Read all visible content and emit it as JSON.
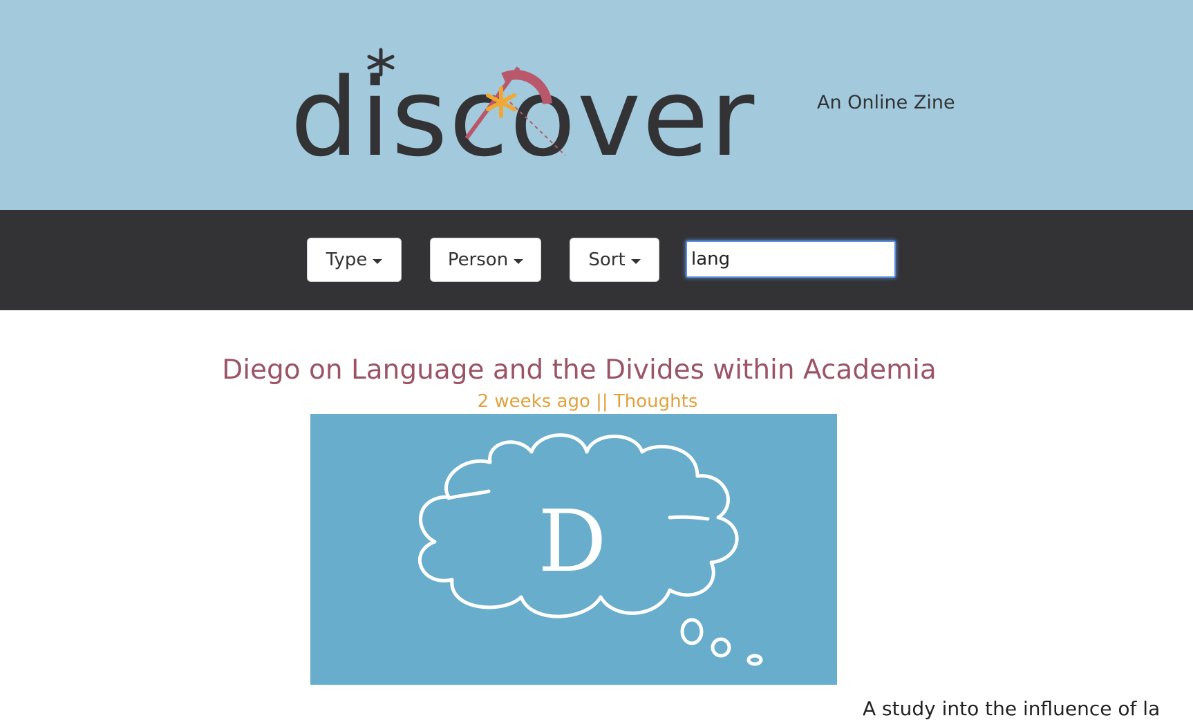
{
  "header": {
    "logo_text": "discover",
    "tagline": "An Online Zine"
  },
  "nav": {
    "type_label": "Type",
    "person_label": "Person",
    "sort_label": "Sort",
    "search_value": "lang"
  },
  "article": {
    "title": "Diego on Language and the Divides within Academia",
    "meta": "2 weeks ago || Thoughts",
    "image_letter": "D",
    "excerpt": "A study into the influence of la"
  },
  "colors": {
    "header_bg": "#a2c9dc",
    "nav_bg": "#333335",
    "title": "#9a5466",
    "meta": "#e0a13a",
    "image_bg": "#68adcb",
    "logo_asterisk": "#f0a834",
    "logo_accent": "#b8586a"
  }
}
